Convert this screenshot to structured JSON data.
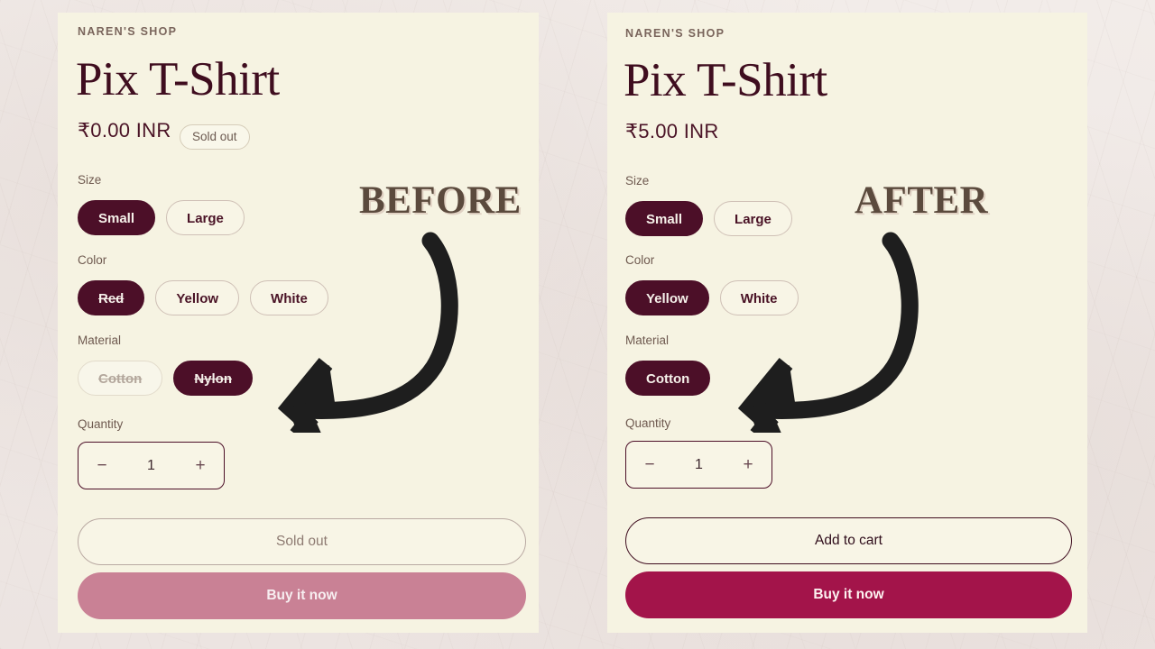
{
  "colors": {
    "card_bg": "#F6F3E2",
    "page_bg": "#EFE9E6",
    "accent_dark": "#4C0F28",
    "buy_active": "#A3144A",
    "buy_disabled": "#C98195",
    "caption": "#5B4A3D",
    "arrow": "#1E1E1E"
  },
  "panels": [
    {
      "caption": "BEFORE",
      "shop_name": "NAREN'S SHOP",
      "title": "Pix T-Shirt",
      "price": "₹0.00 INR",
      "badge": "Sold out",
      "has_badge": true,
      "options": [
        {
          "label": "Size",
          "values": [
            {
              "text": "Small",
              "state": "selected",
              "strike": false
            },
            {
              "text": "Large",
              "state": "unselected",
              "strike": false
            }
          ]
        },
        {
          "label": "Color",
          "values": [
            {
              "text": "Red",
              "state": "selected",
              "strike": true
            },
            {
              "text": "Yellow",
              "state": "unselected",
              "strike": false
            },
            {
              "text": "White",
              "state": "unselected",
              "strike": false
            }
          ]
        },
        {
          "label": "Material",
          "values": [
            {
              "text": "Cotton",
              "state": "disabled",
              "strike": true
            },
            {
              "text": "Nylon",
              "state": "selected",
              "strike": true
            }
          ]
        }
      ],
      "quantity": {
        "label": "Quantity",
        "decrement": "−",
        "value": "1",
        "increment": "+"
      },
      "cart_button": {
        "text": "Sold out",
        "state": "disabled"
      },
      "buy_button": {
        "text": "Buy it now",
        "state": "disabled"
      }
    },
    {
      "caption": "AFTER",
      "shop_name": "NAREN'S SHOP",
      "title": "Pix T-Shirt",
      "price": "₹5.00 INR",
      "badge": "",
      "has_badge": false,
      "options": [
        {
          "label": "Size",
          "values": [
            {
              "text": "Small",
              "state": "selected",
              "strike": false
            },
            {
              "text": "Large",
              "state": "unselected",
              "strike": false
            }
          ]
        },
        {
          "label": "Color",
          "values": [
            {
              "text": "Yellow",
              "state": "selected",
              "strike": false
            },
            {
              "text": "White",
              "state": "unselected",
              "strike": false
            }
          ]
        },
        {
          "label": "Material",
          "values": [
            {
              "text": "Cotton",
              "state": "selected",
              "strike": false
            }
          ]
        }
      ],
      "quantity": {
        "label": "Quantity",
        "decrement": "−",
        "value": "1",
        "increment": "+"
      },
      "cart_button": {
        "text": "Add to cart",
        "state": "active"
      },
      "buy_button": {
        "text": "Buy it now",
        "state": "active"
      }
    }
  ]
}
